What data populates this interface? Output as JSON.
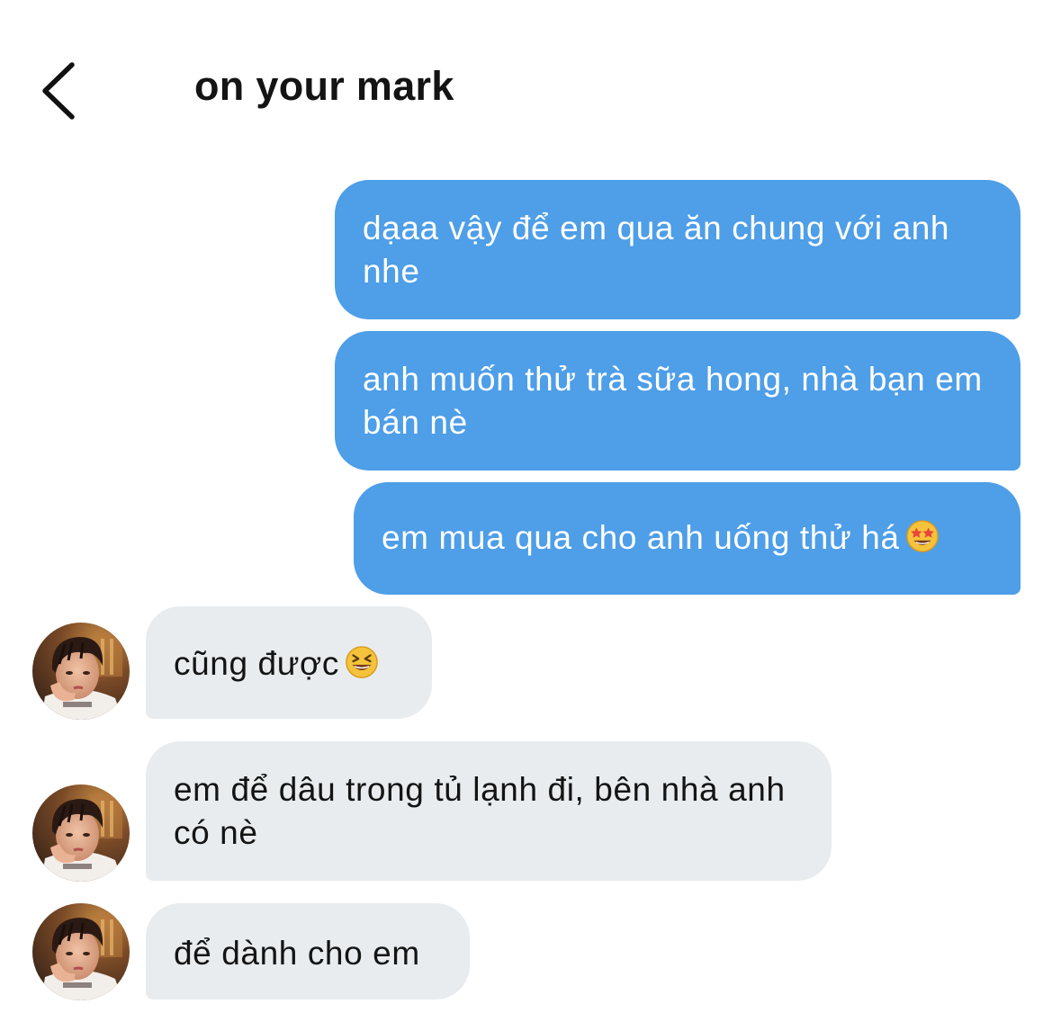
{
  "header": {
    "title": "on your mark",
    "back_icon": "chevron-left-icon"
  },
  "messages": [
    {
      "side": "outgoing",
      "text": "dạaa vậy để em qua ăn chung với anh nhe"
    },
    {
      "side": "outgoing",
      "text": "anh muốn thử trà sữa hong, nhà bạn em bán nè"
    },
    {
      "side": "outgoing",
      "text": "em mua qua cho anh uống thử há",
      "emoji": "star-struck-emoji"
    },
    {
      "side": "incoming",
      "text": "cũng được",
      "emoji": "grinning-squinting-emoji"
    },
    {
      "side": "incoming",
      "text": "em để dâu trong tủ lạnh đi, bên nhà anh có nè"
    },
    {
      "side": "incoming",
      "text": "để dành cho em"
    }
  ],
  "colors": {
    "outgoing_bubble": "#4e9ee8",
    "incoming_bubble": "#e8ecef",
    "outgoing_text": "#ffffff",
    "incoming_text": "#141414"
  }
}
